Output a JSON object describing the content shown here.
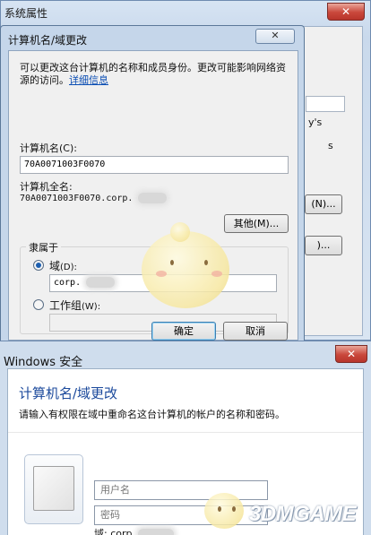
{
  "system_properties": {
    "title": "系统属性",
    "close_label": "✕",
    "text_y": "y's",
    "text_s": "s",
    "btn_change_label": "(N)...",
    "btn_other_label": ")..."
  },
  "computer_name_dialog": {
    "title": "计算机名/域更改",
    "close_label": "✕",
    "description": "可以更改这台计算机的名称和成员身份。更改可能影响网络资源的访问。",
    "details_link": "详细信息",
    "computer_name_label": "计算机名(C):",
    "computer_name_value": "70A0071003F0070",
    "full_name_label": "计算机全名:",
    "full_name_value": "70A0071003F0070.corp.",
    "more_button": "其他(M)...",
    "member_of_label": "隶属于",
    "domain_label": "域",
    "domain_hotkey": "(D):",
    "domain_value": "corp.",
    "workgroup_label": "工作组",
    "workgroup_hotkey": "(W):",
    "workgroup_value": "",
    "ok_button": "确定",
    "cancel_button": "取消"
  },
  "windows_security": {
    "title": "Windows 安全",
    "close_label": "✕",
    "heading": "计算机名/域更改",
    "description": "请输入有权限在域中重命名这台计算机的帐户的名称和密码。",
    "username_placeholder": "用户名",
    "password_placeholder": "密码",
    "domain_text": "域: corp."
  },
  "watermark": "3DMGAME"
}
